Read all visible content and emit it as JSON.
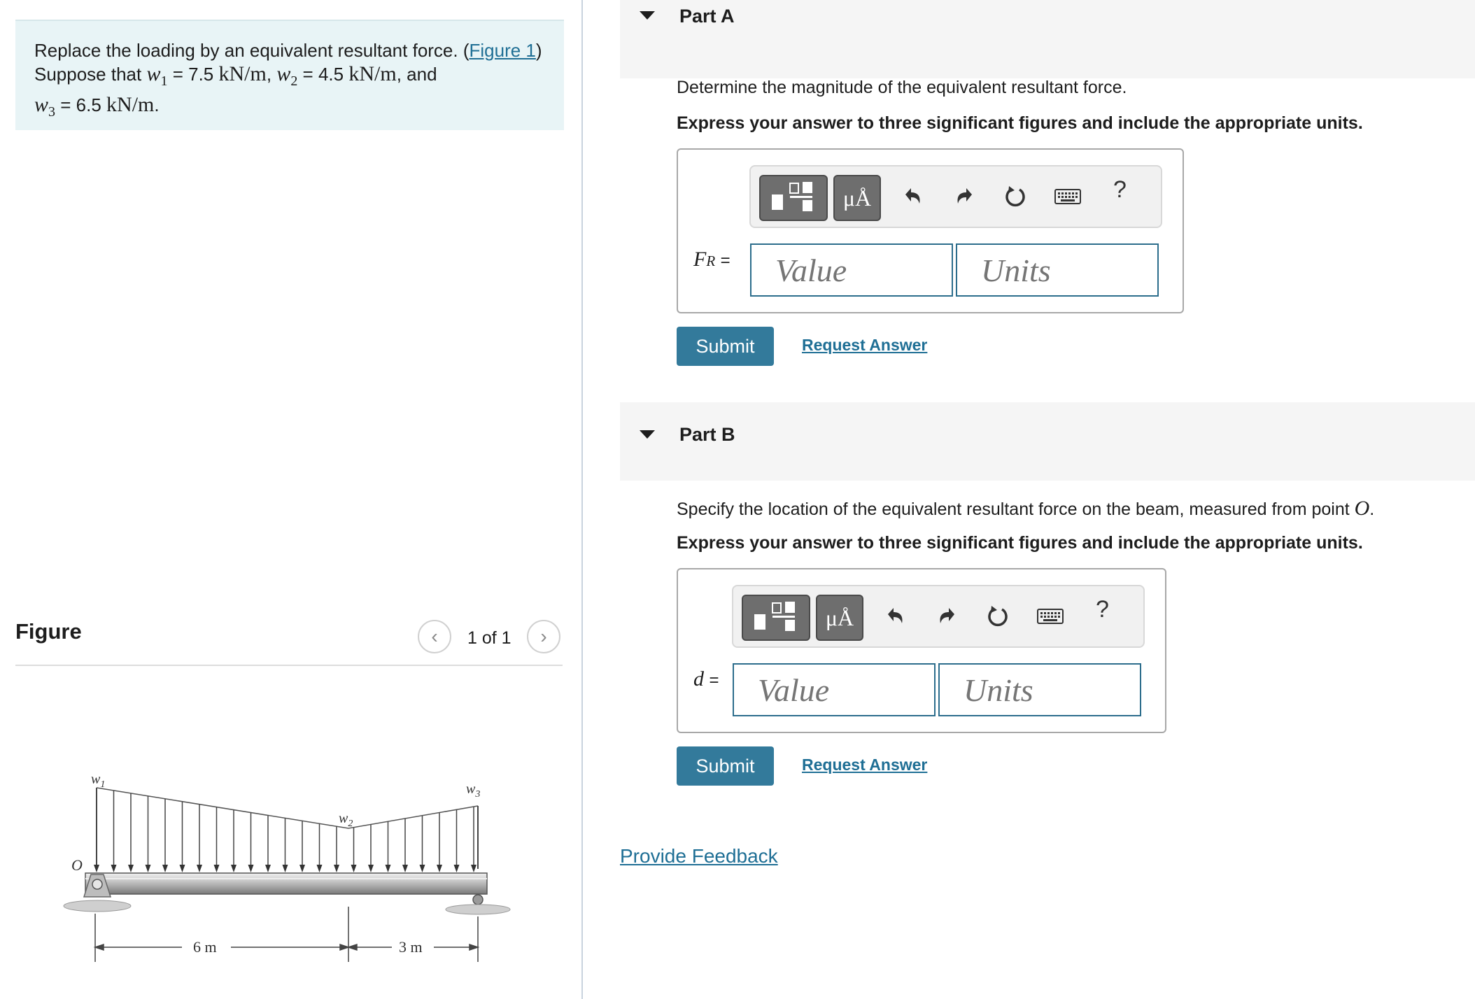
{
  "problem": {
    "text_before_link": "Replace the loading by an equivalent resultant force. (",
    "figure_link": "Figure 1",
    "text_after_link": ")",
    "suppose": "Suppose that",
    "w1_value": "7.5",
    "w2_value": "4.5",
    "w3_value": "6.5",
    "unit": "kN/m",
    "and": "and"
  },
  "figure": {
    "heading": "Figure",
    "counter": "1 of 1",
    "labels": {
      "w1": "w",
      "w2": "w",
      "w3": "w",
      "point_o": "O",
      "dim_left": "6 m",
      "dim_right": "3 m"
    }
  },
  "part_a": {
    "title": "Part A",
    "prompt": "Determine the magnitude of the equivalent resultant force.",
    "instruction": "Express your answer to three significant figures and include the appropriate units.",
    "label_main": "F",
    "label_sub": "R",
    "value_placeholder": "Value",
    "units_placeholder": "Units",
    "submit": "Submit",
    "request": "Request Answer"
  },
  "part_b": {
    "title": "Part B",
    "prompt": "Specify the location of the equivalent resultant force on the beam, measured from point",
    "point": "O",
    "instruction": "Express your answer to three significant figures and include the appropriate units.",
    "label_main": "d",
    "value_placeholder": "Value",
    "units_placeholder": "Units",
    "submit": "Submit",
    "request": "Request Answer"
  },
  "toolbar": {
    "mu_label": "μÅ",
    "help": "?"
  },
  "feedback": "Provide Feedback",
  "colors": {
    "accent": "#337a9b",
    "link": "#1f6f95",
    "problem_bg": "#e8f4f6"
  }
}
